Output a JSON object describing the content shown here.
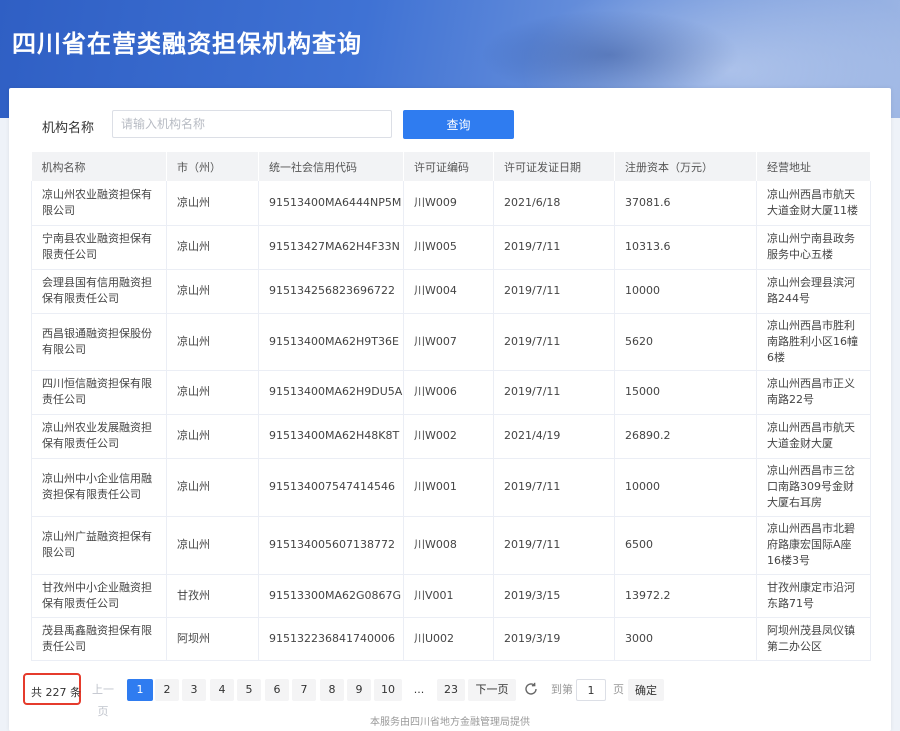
{
  "header": {
    "title": "四川省在营类融资担保机构查询"
  },
  "search": {
    "label": "机构名称",
    "placeholder": "请输入机构名称",
    "button_label": "查询"
  },
  "table": {
    "columns": [
      "机构名称",
      "市（州）",
      "统一社会信用代码",
      "许可证编码",
      "许可证发证日期",
      "注册资本（万元）",
      "经营地址"
    ],
    "rows": [
      {
        "name": "凉山州农业融资担保有限公司",
        "city": "凉山州",
        "credit_code": "91513400MA6444NP5M",
        "license": "川W009",
        "date": "2021/6/18",
        "capital": "37081.6",
        "address": "凉山州西昌市航天大道金财大厦11楼"
      },
      {
        "name": "宁南县农业融资担保有限责任公司",
        "city": "凉山州",
        "credit_code": "91513427MA62H4F33N",
        "license": "川W005",
        "date": "2019/7/11",
        "capital": "10313.6",
        "address": "凉山州宁南县政务服务中心五楼"
      },
      {
        "name": "会理县国有信用融资担保有限责任公司",
        "city": "凉山州",
        "credit_code": "915134256823696722",
        "license": "川W004",
        "date": "2019/7/11",
        "capital": "10000",
        "address": "凉山州会理县滨河路244号"
      },
      {
        "name": "西昌银通融资担保股份有限公司",
        "city": "凉山州",
        "credit_code": "91513400MA62H9T36E",
        "license": "川W007",
        "date": "2019/7/11",
        "capital": "5620",
        "address": "凉山州西昌市胜利南路胜利小区16幢6楼"
      },
      {
        "name": "四川恒信融资担保有限责任公司",
        "city": "凉山州",
        "credit_code": "91513400MA62H9DU5A",
        "license": "川W006",
        "date": "2019/7/11",
        "capital": "15000",
        "address": "凉山州西昌市正义南路22号"
      },
      {
        "name": "凉山州农业发展融资担保有限责任公司",
        "city": "凉山州",
        "credit_code": "91513400MA62H48K8T",
        "license": "川W002",
        "date": "2021/4/19",
        "capital": "26890.2",
        "address": "凉山州西昌市航天大道金财大厦"
      },
      {
        "name": "凉山州中小企业信用融资担保有限责任公司",
        "city": "凉山州",
        "credit_code": "915134007547414546",
        "license": "川W001",
        "date": "2019/7/11",
        "capital": "10000",
        "address": "凉山州西昌市三岔口南路309号金财大厦右耳房"
      },
      {
        "name": "凉山州广益融资担保有限公司",
        "city": "凉山州",
        "credit_code": "915134005607138772",
        "license": "川W008",
        "date": "2019/7/11",
        "capital": "6500",
        "address": "凉山州西昌市北碧府路康宏国际A座16楼3号"
      },
      {
        "name": "甘孜州中小企业融资担保有限责任公司",
        "city": "甘孜州",
        "credit_code": "91513300MA62G0867G",
        "license": "川V001",
        "date": "2019/3/15",
        "capital": "13972.2",
        "address": "甘孜州康定市沿河东路71号"
      },
      {
        "name": "茂县禹鑫融资担保有限责任公司",
        "city": "阿坝州",
        "credit_code": "915132236841740006",
        "license": "川U002",
        "date": "2019/3/19",
        "capital": "3000",
        "address": "阿坝州茂县凤仪镇第二办公区"
      }
    ]
  },
  "pagination": {
    "total": "共 227 条",
    "prev": "上一页",
    "pages": [
      "1",
      "2",
      "3",
      "4",
      "5",
      "6",
      "7",
      "8",
      "9",
      "10"
    ],
    "ellipsis": "...",
    "last": "23",
    "next": "下一页",
    "goto_label": "到第",
    "goto_value": "1",
    "page_unit": "页",
    "confirm": "确定",
    "current": "1"
  },
  "footer": {
    "note": "本服务由四川省地方金融管理局提供"
  },
  "colors": {
    "primary": "#2f7cf0",
    "highlight_border": "#e53b2c"
  }
}
